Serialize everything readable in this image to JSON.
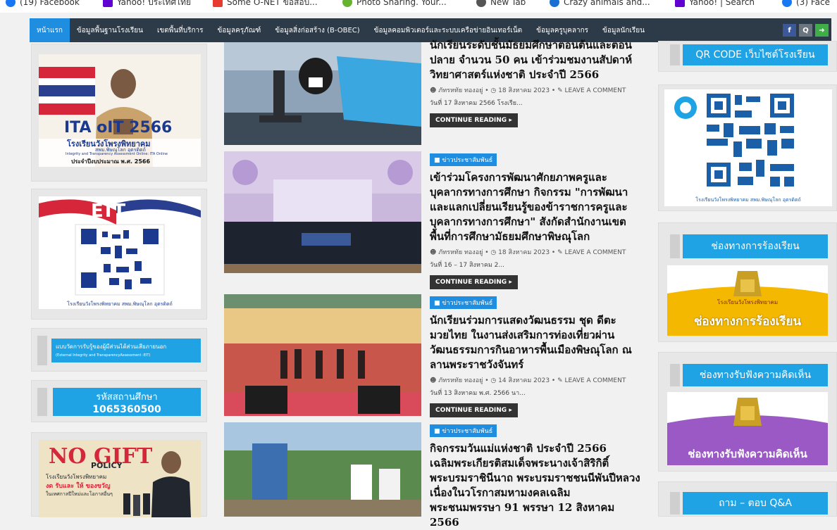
{
  "bookmarks": [
    {
      "label": "(19) Facebook",
      "color": "#1877f2"
    },
    {
      "label": "Yahoo! ประเทศไทย",
      "color": "#6001d2"
    },
    {
      "label": "Some O-NET ข้อสอบ...",
      "color": "#e63b2e"
    },
    {
      "label": "Photo Sharing. Your...",
      "color": "#65b32e"
    },
    {
      "label": "New Tab",
      "color": "#555555"
    },
    {
      "label": "Crazy animals and...",
      "color": "#1a6fd3"
    },
    {
      "label": "Yahoo! | Search",
      "color": "#6001d2"
    },
    {
      "label": "(3) Face",
      "color": "#1877f2"
    }
  ],
  "nav": {
    "items": [
      "หน้าแรก",
      "ข้อมูลพื้นฐานโรงเรียน",
      "เขตพื้นที่บริการ",
      "ข้อมูลครุภัณฑ์",
      "ข้อมูลสิ่งก่อสร้าง (B-OBEC)",
      "ข้อมูลคอมพิวเตอร์และระบบเครือข่ายอินเทอร์เน็ต",
      "ข้อมูลครูบุคลากร",
      "ข้อมูลนักเรียน"
    ],
    "tools": [
      "f",
      "Q",
      "➜"
    ]
  },
  "left": {
    "ita_title": "ITA oIT 2566",
    "ita_school": "โรงเรียนวังโพรงพิทยาคม",
    "ita_sub": "สพม.พิษณุโลก อุตรดิตถ์",
    "ita_caption": "Integrity and Transparency Assessment Online: ITA Online",
    "ita_year": "ประจำปีงบประมาณ พ.ศ. 2566",
    "eit_label": "EIT",
    "eit_caption": "โรงเรียนวังโพรงพิทยาคม สพม.พิษณุโลก อุตรดิตถ์",
    "eit_button_line1": "แบบวัดการรับรู้ของผู้มีส่วนได้ส่วนเสียภายนอก",
    "eit_button_line2": "(External Integrity and TransparencyAssessment :EIT)",
    "code_label": "รหัสสถานศึกษา",
    "code_value": "1065360500",
    "nogift_title": "NO GIFT",
    "nogift_policy": "POLICY",
    "nogift_school": "โรงเรียนวังโพรงพิทยาคม",
    "nogift_slogan": "งด รับและ ให้ ของขวัญ",
    "nogift_note": "ในเทศกาลปีใหม่และโอกาสอื่นๆ"
  },
  "posts": [
    {
      "category": "",
      "title": "นักเรียนระดับชั้นมัธยมศึกษาตอนต้นและตอนปลาย จำนวน 50 คน เข้าร่วมชมงานสัปดาห์วิทยาศาสตร์แห่งชาติ ประจำปี 2566",
      "author": "ภัทรหทัย ทองอยู่",
      "date": "18 สิงหาคม 2023",
      "comment": "LEAVE A COMMENT",
      "excerpt": "วันที่ 17 สิงหาคม 2566 โรงเรีย...",
      "more": "CONTINUE READING ▸"
    },
    {
      "category": "ข่าวประชาสัมพันธ์",
      "title": "เข้าร่วมโครงการพัฒนาศักยภาพครูและบุคลากรทางการศึกษา กิจกรรม \"การพัฒนาและแลกเปลี่ยนเรียนรู้ของข้าราชการครูและบุคลากรทางการศึกษา\" สังกัดสำนักงานเขตพื้นที่การศึกษามัธยมศึกษาพิษณุโลก",
      "author": "ภัทรหทัย ทองอยู่",
      "date": "18 สิงหาคม 2023",
      "comment": "LEAVE A COMMENT",
      "excerpt": "วันที่ 16 – 17 สิงหาคม 2...",
      "more": "CONTINUE READING ▸"
    },
    {
      "category": "ข่าวประชาสัมพันธ์",
      "title": "นักเรียนร่วมการแสดงวัฒนธรรม ชุด ดีตะมวยไทย ในงานส่งเสริมการท่องเที่ยวผ่านวัฒนธรรมการกินอาหารพื้นเมืองพิษณุโลก ณ ลานพระราชวังจันทร์",
      "author": "ภัทรหทัย ทองอยู่",
      "date": "14 สิงหาคม 2023",
      "comment": "LEAVE A COMMENT",
      "excerpt": "วันที่ 13 สิงหาคม พ.ศ. 2566 นา...",
      "more": "CONTINUE READING ▸"
    },
    {
      "category": "ข่าวประชาสัมพันธ์",
      "title": "กิจกรรมวันแม่แห่งชาติ ประจำปี 2566 เฉลิมพระเกียรติสมเด็จพระนางเจ้าสิริกิติ์พระบรมราชินีนาถ พระบรมราชชนนีพันปีหลวง เนื่องในวโรกาสมหามงคลเฉลิมพระชนมพรรษา 91 พรรษา 12 สิงหาคม 2566",
      "author": "",
      "date": "",
      "comment": "",
      "excerpt": "",
      "more": ""
    }
  ],
  "right": {
    "qr_button": "QR CODE เว็บไซต์โรงเรียน",
    "qr_caption": "โรงเรียนวังโพรงพิทยาคม สพม.พิษณุโลก อุตรดิตถ์",
    "complaint_button": "ช่องทางการร้องเรียน",
    "complaint_banner": "ช่องทางการร้องเรียน",
    "complaint_school": "โรงเรียนวังโพรงพิทยาคม",
    "feedback_button": "ช่องทางรับฟังความคิดเห็น",
    "feedback_banner": "ช่องทางรับฟังความคิดเห็น",
    "faq_button": "ถาม – ตอบ Q&A"
  }
}
